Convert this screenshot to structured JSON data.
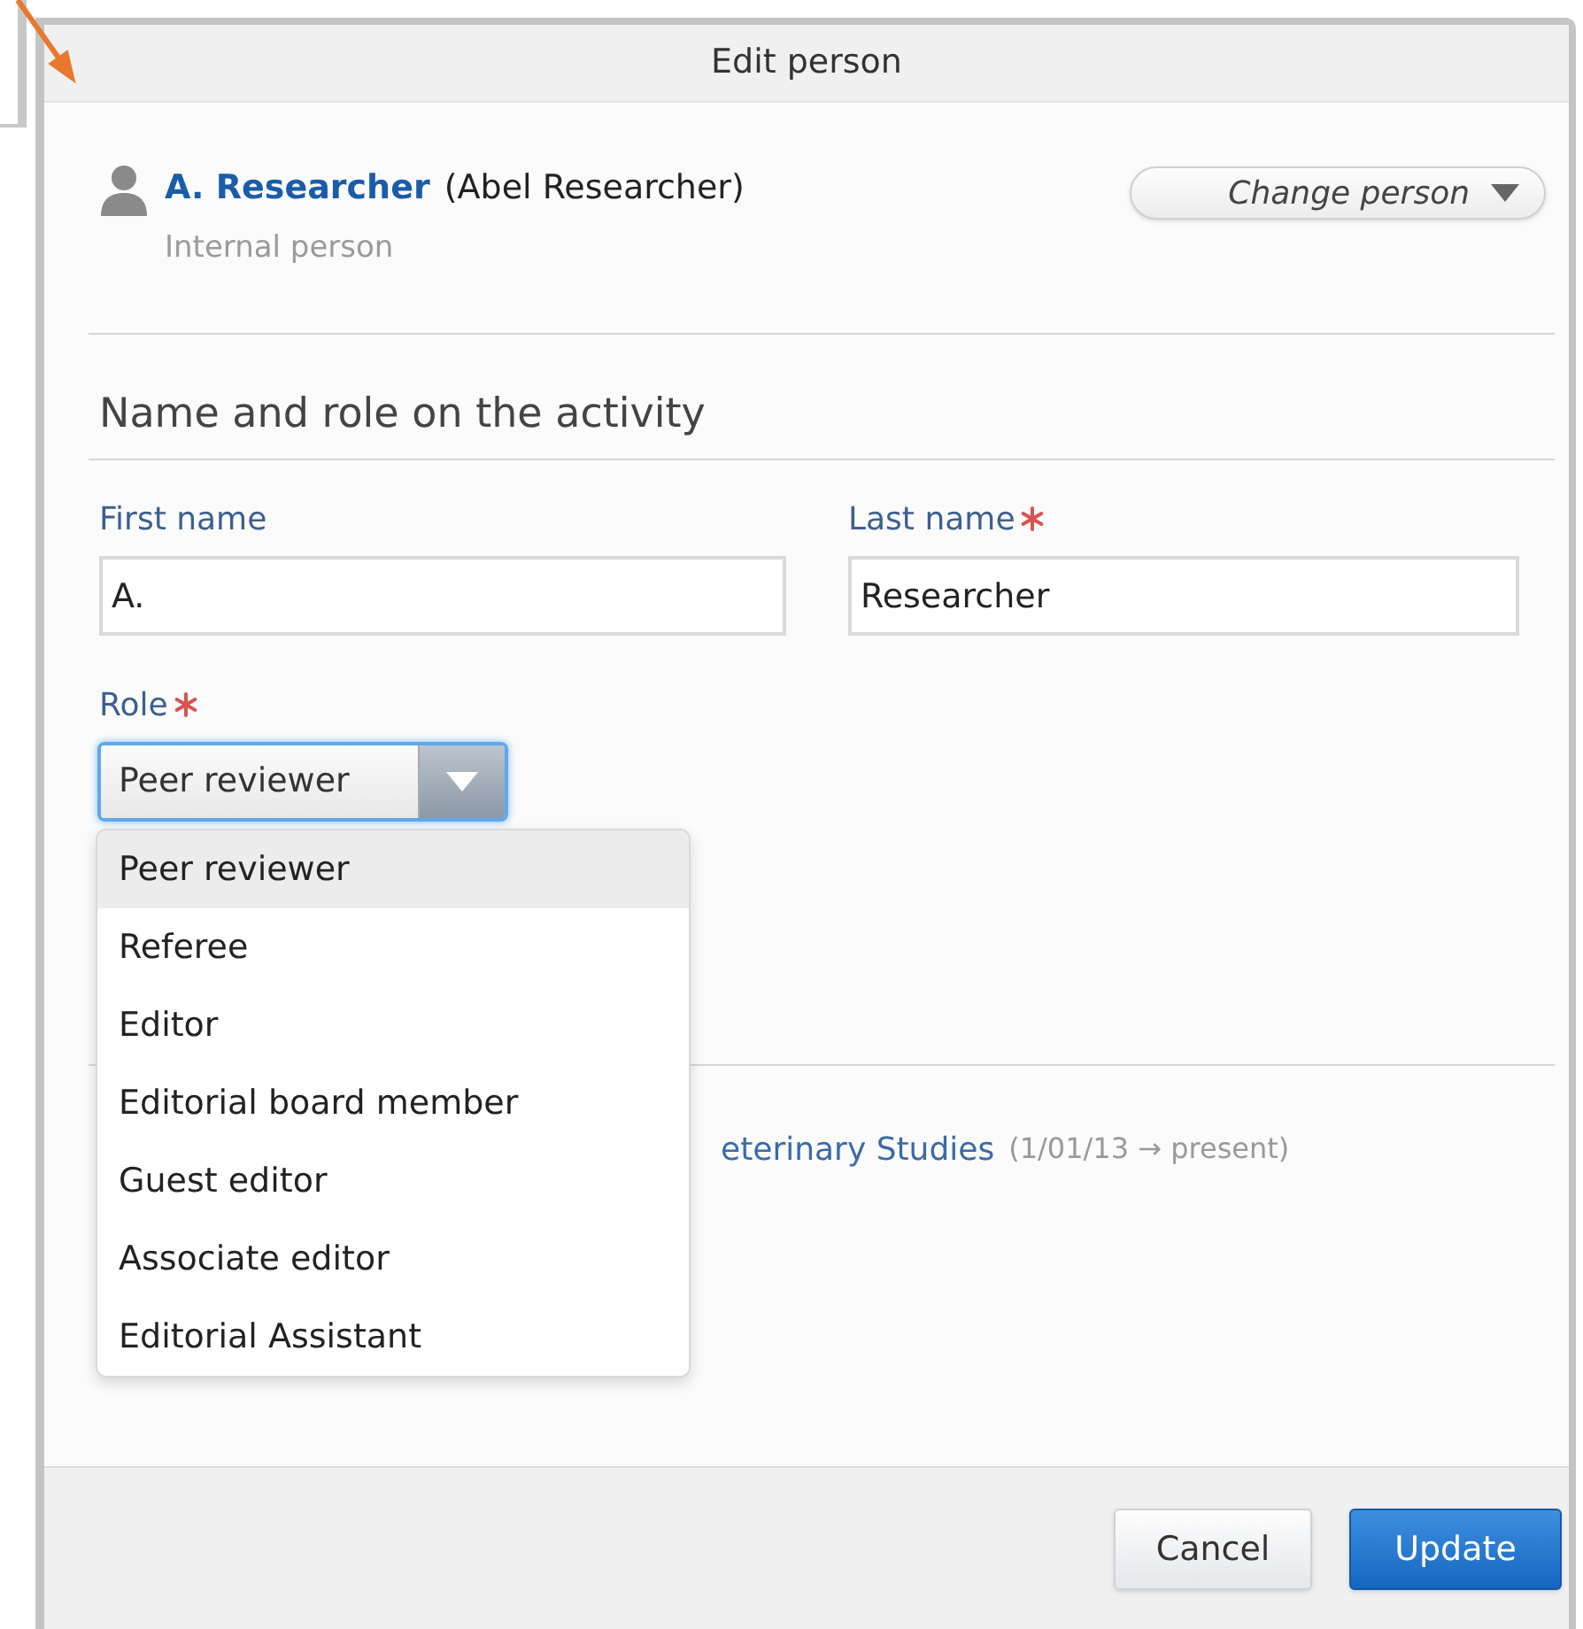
{
  "dialog": {
    "title": "Edit person"
  },
  "person": {
    "name": "A. Researcher",
    "full_name": "(Abel Researcher)",
    "type": "Internal person"
  },
  "change_person_button": {
    "label": "Change person"
  },
  "section": {
    "heading": "Name and role on the activity"
  },
  "fields": [
    {
      "label": "First name",
      "required": false,
      "value": "A."
    },
    {
      "label": "Last name",
      "required": true,
      "value": "Researcher"
    }
  ],
  "role": {
    "label": "Role",
    "required": true,
    "value": "Peer reviewer",
    "focused": true,
    "options": [
      {
        "label": "Peer reviewer",
        "selected": true
      },
      {
        "label": "Referee",
        "selected": false
      },
      {
        "label": "Editor",
        "selected": false
      },
      {
        "label": "Editorial board member",
        "selected": false
      },
      {
        "label": "Guest editor",
        "selected": false
      },
      {
        "label": "Associate editor",
        "selected": false
      },
      {
        "label": "Editorial Assistant",
        "selected": false
      }
    ]
  },
  "affiliation": {
    "organisation": "eterinary Studies",
    "period": "(1/01/13 → present)"
  },
  "buttons": [
    {
      "label": "Cancel",
      "kind": "secondary"
    },
    {
      "label": "Update",
      "kind": "primary"
    }
  ]
}
